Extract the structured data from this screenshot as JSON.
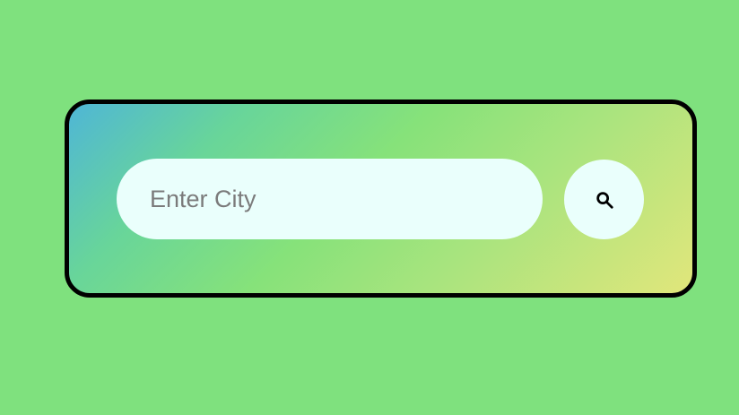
{
  "search": {
    "placeholder": "Enter City",
    "value": "",
    "button_icon": "search-icon"
  },
  "colors": {
    "page_background": "#7fe17e",
    "card_border": "#000000",
    "gradient_start": "#4fb6d6",
    "gradient_middle": "#86e27a",
    "gradient_end": "#e1e67b",
    "control_background": "#eafffc",
    "placeholder_text": "#7b7b7b"
  }
}
